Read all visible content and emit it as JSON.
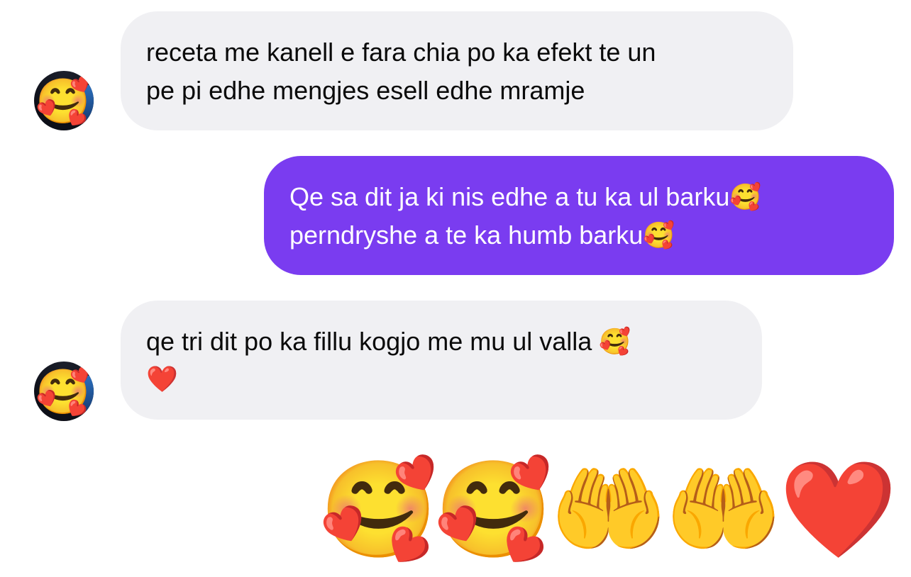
{
  "messages": [
    {
      "direction": "incoming",
      "lines": [
        "receta me kanell e fara chia po ka efekt te un",
        "pe pi edhe mengjes esell edhe mramje"
      ]
    },
    {
      "direction": "outgoing",
      "lines": [
        "Qe sa dit ja ki nis edhe a tu ka ul barku🥰",
        "perndryshe a te ka humb barku🥰"
      ]
    },
    {
      "direction": "incoming",
      "lines": [
        "qe tri dit po ka fillu kogjo me mu ul valla 🥰",
        "❤️"
      ]
    }
  ],
  "avatar": {
    "emoji": "🥰"
  },
  "reaction_emojis": [
    "🥰",
    "🥰",
    "🤲",
    "🤲",
    "❤️"
  ],
  "colors": {
    "incoming_bubble": "#f0f0f3",
    "outgoing_bubble": "#7a3cf0",
    "incoming_text": "#0a0a0a",
    "outgoing_text": "#ffffff"
  }
}
